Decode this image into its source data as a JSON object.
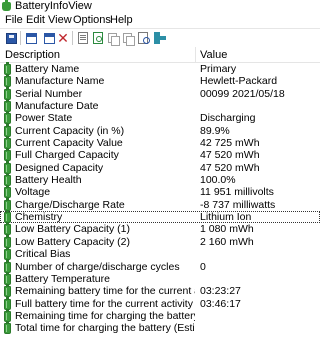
{
  "window": {
    "title": "BatteryInfoView"
  },
  "menu": [
    "File",
    "Edit",
    "View",
    "Options",
    "Help"
  ],
  "toolbar": {
    "icons": [
      "save-icon",
      "html-report-icon",
      "properties-icon",
      "delete-icon",
      "page-icon",
      "refresh-icon",
      "copy-icon",
      "copy-all-icon",
      "find-icon",
      "exit-icon"
    ]
  },
  "columns": {
    "description": "Description",
    "value": "Value"
  },
  "rows": [
    {
      "label": "Battery Name",
      "value": "Primary"
    },
    {
      "label": "Manufacture Name",
      "value": "Hewlett-Packard"
    },
    {
      "label": "Serial Number",
      "value": "00099 2021/05/18"
    },
    {
      "label": "Manufacture Date",
      "value": ""
    },
    {
      "label": "Power State",
      "value": "Discharging"
    },
    {
      "label": "Current Capacity (in %)",
      "value": "89.9%"
    },
    {
      "label": "Current Capacity Value",
      "value": "42 725 mWh"
    },
    {
      "label": "Full Charged Capacity",
      "value": "47 520 mWh"
    },
    {
      "label": "Designed Capacity",
      "value": "47 520 mWh"
    },
    {
      "label": "Battery Health",
      "value": "100.0%"
    },
    {
      "label": "Voltage",
      "value": "11 951 millivolts"
    },
    {
      "label": "Charge/Discharge Rate",
      "value": "-8 737 milliwatts"
    },
    {
      "label": "Chemistry",
      "value": "Lithium Ion",
      "selected": true
    },
    {
      "label": "Low Battery Capacity (1)",
      "value": "1 080 mWh"
    },
    {
      "label": "Low Battery Capacity (2)",
      "value": "2 160 mWh"
    },
    {
      "label": "Critical Bias",
      "value": ""
    },
    {
      "label": "Number of charge/discharge cycles",
      "value": "0"
    },
    {
      "label": "Battery Temperature",
      "value": ""
    },
    {
      "label": "Remaining battery time for the current activity (Est...",
      "value": "03:23:27"
    },
    {
      "label": "Full battery time for the current activity (Estimated)",
      "value": "03:46:17"
    },
    {
      "label": "Remaining time for charging the battery (Estimated)",
      "value": ""
    },
    {
      "label": "Total  time for charging the battery (Estimated)",
      "value": ""
    }
  ]
}
